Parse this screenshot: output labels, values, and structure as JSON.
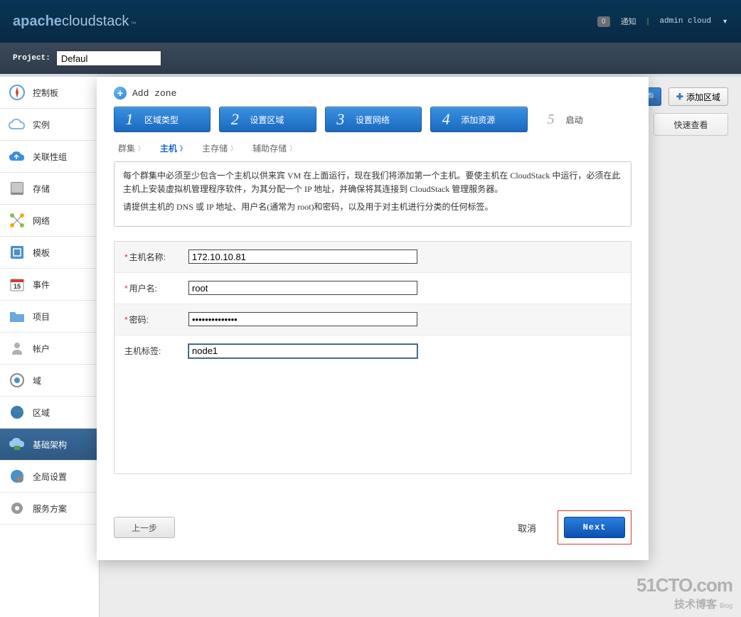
{
  "header": {
    "logo_apache": "apache",
    "logo_cloud": "cloud",
    "logo_stack": "stack",
    "notif_count": "0",
    "notif_label": "通知",
    "user": "admin cloud"
  },
  "subhead": {
    "project_label": "Project:",
    "project_value": "Defaul"
  },
  "nav": [
    {
      "label": "控制板",
      "icon": "compass"
    },
    {
      "label": "实例",
      "icon": "cloud"
    },
    {
      "label": "关联性组",
      "icon": "cloud-up"
    },
    {
      "label": "存储",
      "icon": "disk"
    },
    {
      "label": "网络",
      "icon": "network"
    },
    {
      "label": "模板",
      "icon": "template"
    },
    {
      "label": "事件",
      "icon": "calendar"
    },
    {
      "label": "项目",
      "icon": "folder"
    },
    {
      "label": "帐户",
      "icon": "user"
    },
    {
      "label": "域",
      "icon": "target"
    },
    {
      "label": "区域",
      "icon": "globe"
    },
    {
      "label": "基础架构",
      "icon": "infra",
      "active": true
    },
    {
      "label": "全局设置",
      "icon": "globe-gear"
    },
    {
      "label": "服务方案",
      "icon": "gear"
    }
  ],
  "content": {
    "add_zone_btn": "添加区域",
    "quick_view": "快速查看"
  },
  "dialog": {
    "title": "Add zone",
    "steps": [
      {
        "num": "1",
        "label": "区域类型"
      },
      {
        "num": "2",
        "label": "设置区域"
      },
      {
        "num": "3",
        "label": "设置网络"
      },
      {
        "num": "4",
        "label": "添加资源"
      },
      {
        "num": "5",
        "label": "启动"
      }
    ],
    "tabs": [
      {
        "label": "群集"
      },
      {
        "label": "主机",
        "active": true
      },
      {
        "label": "主存储"
      },
      {
        "label": "辅助存储"
      }
    ],
    "info_p1": "每个群集中必须至少包含一个主机以供来宾 VM 在上面运行，现在我们将添加第一个主机。要使主机在 CloudStack 中运行，必须在此主机上安装虚拟机管理程序软件，为其分配一个 IP 地址，并确保将其连接到 CloudStack 管理服务器。",
    "info_p2": "请提供主机的 DNS 或 IP 地址、用户名(通常为 root)和密码，以及用于对主机进行分类的任何标签。",
    "form": {
      "hostname_label": "主机名称:",
      "hostname_value": "172.10.10.81",
      "username_label": "用户名:",
      "username_value": "root",
      "password_label": "密码:",
      "password_value": "••••••••••••••",
      "tag_label": "主机标签:",
      "tag_value": "node1"
    },
    "footer": {
      "prev": "上一步",
      "cancel": "取消",
      "next": "Next"
    }
  },
  "watermark": {
    "line1": "51CTO.com",
    "line2": "技术博客",
    "blog": "Blog"
  }
}
